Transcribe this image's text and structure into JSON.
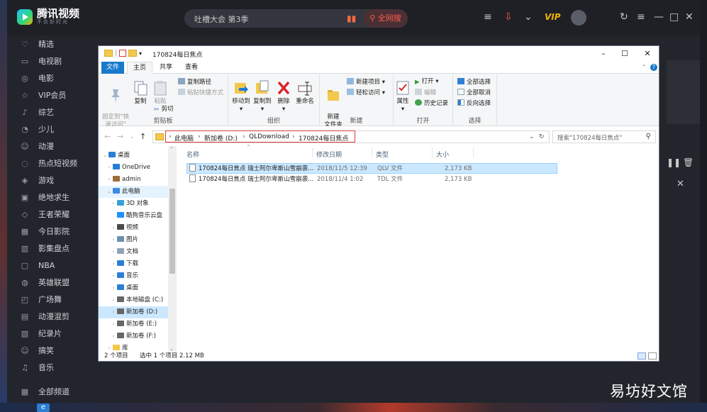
{
  "player": {
    "logo_text": "腾讯视频",
    "logo_sub": "不负好时光",
    "search_placeholder": "吐槽大会 第3季",
    "search_button": "全网搜",
    "vip_label": "VIP",
    "watermark": "易坊好文馆",
    "nav": [
      {
        "label": "精选",
        "icon": "thumb-icon"
      },
      {
        "label": "电视剧",
        "icon": "tv-icon"
      },
      {
        "label": "电影",
        "icon": "film-icon"
      },
      {
        "label": "VIP会员",
        "icon": "crown-icon"
      },
      {
        "label": "综艺",
        "icon": "mic-icon"
      },
      {
        "label": "少儿",
        "icon": "kid-icon"
      },
      {
        "label": "动漫",
        "icon": "anime-icon"
      },
      {
        "label": "热点短视频",
        "icon": "hot-icon"
      },
      {
        "label": "游戏",
        "icon": "game-icon"
      },
      {
        "label": "绝地求生",
        "icon": "target-icon"
      },
      {
        "label": "王者荣耀",
        "icon": "crest-icon"
      },
      {
        "label": "今日影院",
        "icon": "cinema-icon"
      },
      {
        "label": "影集盘点",
        "icon": "list-icon"
      },
      {
        "label": "NBA",
        "icon": "ball-icon"
      },
      {
        "label": "英雄联盟",
        "icon": "shield-icon"
      },
      {
        "label": "广场舞",
        "icon": "dance-icon"
      },
      {
        "label": "动漫混剪",
        "icon": "cut-icon"
      },
      {
        "label": "纪录片",
        "icon": "doc-icon"
      },
      {
        "label": "搞笑",
        "icon": "smile-icon"
      },
      {
        "label": "音乐",
        "icon": "music-icon"
      }
    ],
    "all_channels": "全部频道"
  },
  "explorer": {
    "title": "170824每日焦点",
    "tabs": [
      "文件",
      "主页",
      "共享",
      "查看"
    ],
    "ribbon": {
      "clipboard": {
        "pin": "固定到\"快\n速访问\"",
        "copy": "复制",
        "paste": "粘贴",
        "copy_path": "复制路径",
        "paste_shortcut": "粘贴快捷方式",
        "cut": "剪切",
        "label": "剪贴板"
      },
      "organize": {
        "move_to": "移动到",
        "copy_to": "复制到",
        "delete": "删除",
        "rename": "重命名",
        "label": "组织"
      },
      "new": {
        "new_folder": "新建\n文件夹",
        "new_item": "新建项目",
        "easy_access": "轻松访问",
        "label": "新建"
      },
      "open": {
        "properties": "属性",
        "open": "打开",
        "edit": "编辑",
        "history": "历史记录",
        "label": "打开"
      },
      "select": {
        "select_all": "全部选择",
        "select_none": "全部取消",
        "invert": "反向选择",
        "label": "选择"
      }
    },
    "breadcrumb": [
      "此电脑",
      "新加卷 (D:)",
      "QLDownload",
      "170824每日焦点"
    ],
    "search_placeholder": "搜索\"170824每日焦点\"",
    "tree": [
      {
        "label": "桌面",
        "level": 0,
        "expand": "v",
        "icon": "desktop-icon"
      },
      {
        "label": "OneDrive",
        "level": 1,
        "expand": ">",
        "icon": "cloud-icon"
      },
      {
        "label": "admin",
        "level": 1,
        "expand": ">",
        "icon": "user-icon"
      },
      {
        "label": "此电脑",
        "level": 1,
        "expand": "v",
        "icon": "computer-icon"
      },
      {
        "label": "3D 对象",
        "level": 2,
        "expand": ">",
        "icon": "cube-icon"
      },
      {
        "label": "酷狗音乐云盘",
        "level": 2,
        "expand": "",
        "icon": "kugou-icon"
      },
      {
        "label": "视频",
        "level": 2,
        "expand": ">",
        "icon": "video-icon"
      },
      {
        "label": "图片",
        "level": 2,
        "expand": ">",
        "icon": "picture-icon"
      },
      {
        "label": "文档",
        "level": 2,
        "expand": ">",
        "icon": "document-icon"
      },
      {
        "label": "下载",
        "level": 2,
        "expand": ">",
        "icon": "download-icon"
      },
      {
        "label": "音乐",
        "level": 2,
        "expand": ">",
        "icon": "music-icon"
      },
      {
        "label": "桌面",
        "level": 2,
        "expand": ">",
        "icon": "desktop-icon"
      },
      {
        "label": "本地磁盘 (C:)",
        "level": 2,
        "expand": ">",
        "icon": "drive-icon"
      },
      {
        "label": "新加卷 (D:)",
        "level": 2,
        "expand": ">",
        "icon": "drive-icon"
      },
      {
        "label": "新加卷 (E:)",
        "level": 2,
        "expand": ">",
        "icon": "drive-icon"
      },
      {
        "label": "新加卷 (F:)",
        "level": 2,
        "expand": ">",
        "icon": "drive-icon"
      },
      {
        "label": "库",
        "level": 1,
        "expand": ">",
        "icon": "library-icon"
      }
    ],
    "columns": [
      "名称",
      "修改日期",
      "类型",
      "大小"
    ],
    "files": [
      {
        "name": "170824每日焦点 瑞士阿尔卑斯山雪崩袭...",
        "date": "2018/11/5 12:39",
        "type": "QLV 文件",
        "size": "2,173 KB"
      },
      {
        "name": "170824每日焦点 瑞士阿尔卑斯山雪崩袭...",
        "date": "2018/11/4 1:02",
        "type": "TDL 文件",
        "size": "2,173 KB"
      }
    ],
    "status": {
      "count": "2 个项目",
      "selected": "选中 1 个项目  2.12 MB"
    }
  }
}
